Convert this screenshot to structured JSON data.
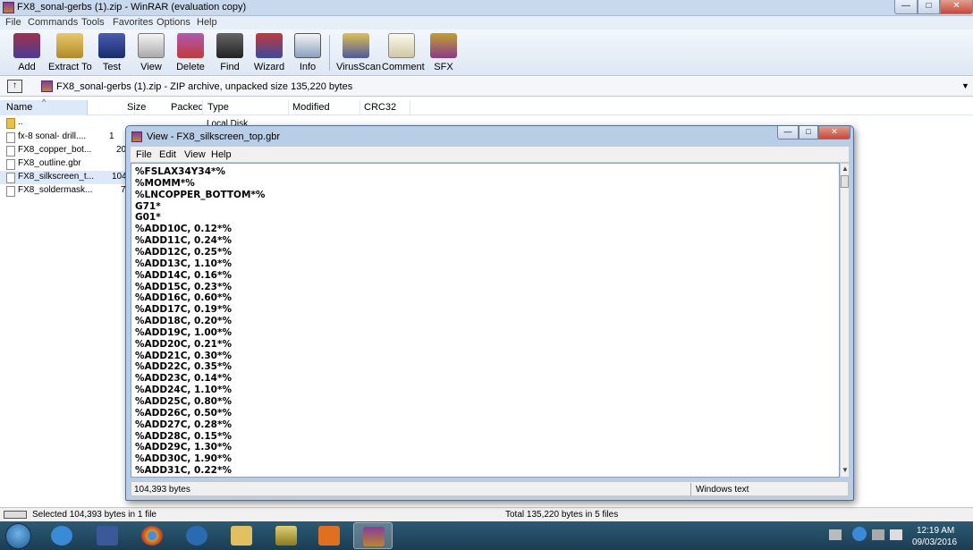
{
  "window": {
    "title": "FX8_sonal-gerbs (1).zip - WinRAR (evaluation copy)",
    "controls": {
      "minimize": "—",
      "maximize": "□",
      "close": "✕"
    }
  },
  "menu": [
    "File",
    "Commands",
    "Tools",
    "Favorites",
    "Options",
    "Help"
  ],
  "toolbar": [
    {
      "label": "Add",
      "icon": "add-icon",
      "color": "#a0324a"
    },
    {
      "label": "Extract To",
      "icon": "extract-folder-icon",
      "color": "#c9a040"
    },
    {
      "label": "Test",
      "icon": "test-book-icon",
      "color": "#2a3c8c"
    },
    {
      "label": "View",
      "icon": "view-glasses-icon",
      "color": "#8a8a8a"
    },
    {
      "label": "Delete",
      "icon": "delete-books-icon",
      "color": "#8a3a8a"
    },
    {
      "label": "Find",
      "icon": "find-binoculars-icon",
      "color": "#444444"
    },
    {
      "label": "Wizard",
      "icon": "wizard-hat-icon",
      "color": "#5a4aa0"
    },
    {
      "label": "Info",
      "icon": "info-icon",
      "color": "#3a5a8c"
    },
    {
      "label": "VirusScan",
      "icon": "virusscan-icon",
      "color": "#c0a030"
    },
    {
      "label": "Comment",
      "icon": "comment-icon",
      "color": "#d0d0c0"
    },
    {
      "label": "SFX",
      "icon": "sfx-icon",
      "color": "#b04a8a"
    }
  ],
  "address": {
    "text": "FX8_sonal-gerbs (1).zip - ZIP archive, unpacked size 135,220 bytes",
    "up_icon": "↑",
    "dropdown_icon": "▼"
  },
  "columns": {
    "name": "Name",
    "sort_indicator": "^",
    "size": "Size",
    "packed": "Packed",
    "type": "Type",
    "modified": "Modified",
    "crc": "CRC32"
  },
  "local_disk": "Local Disk",
  "files": [
    {
      "name": "..",
      "size": "",
      "kind": "folder"
    },
    {
      "name": "fx-8 sonal- drill....",
      "size": "1",
      "kind": "file"
    },
    {
      "name": "FX8_copper_bot...",
      "size": "20",
      "kind": "file"
    },
    {
      "name": "FX8_outline.gbr",
      "size": "",
      "kind": "file"
    },
    {
      "name": "FX8_silkscreen_t...",
      "size": "104",
      "kind": "file",
      "selected": true
    },
    {
      "name": "FX8_soldermask...",
      "size": "7",
      "kind": "file"
    }
  ],
  "status": {
    "left": "Selected 104,393 bytes in 1 file",
    "right": "Total 135,220 bytes in 5 files"
  },
  "viewer": {
    "title": "View - FX8_silkscreen_top.gbr",
    "controls": {
      "minimize": "—",
      "maximize": "□",
      "close": "✕"
    },
    "menu": [
      "File",
      "Edit",
      "View",
      "Help"
    ],
    "lines": [
      "%FSLAX34Y34*%",
      "%MOMM*%",
      "%LNCOPPER_BOTTOM*%",
      "G71*",
      "G01*",
      "%ADD10C, 0.12*%",
      "%ADD11C, 0.24*%",
      "%ADD12C, 0.25*%",
      "%ADD13C, 1.10*%",
      "%ADD14C, 0.16*%",
      "%ADD15C, 0.23*%",
      "%ADD16C, 0.60*%",
      "%ADD17C, 0.19*%",
      "%ADD18C, 0.20*%",
      "%ADD19C, 1.00*%",
      "%ADD20C, 0.21*%",
      "%ADD21C, 0.30*%",
      "%ADD22C, 0.35*%",
      "%ADD23C, 0.14*%",
      "%ADD24C, 1.10*%",
      "%ADD25C, 0.80*%",
      "%ADD26C, 0.50*%",
      "%ADD27C, 0.28*%",
      "%ADD28C, 0.15*%",
      "%ADD29C, 1.30*%",
      "%ADD30C, 1.90*%",
      "%ADD31C, 0.22*%"
    ],
    "status_left": "104,393 bytes",
    "status_right": "Windows text",
    "scroll_up": "▲",
    "scroll_down": "▼"
  },
  "taskbar": {
    "apps": [
      {
        "name": "internet-explorer",
        "color": "#3a8ad8"
      },
      {
        "name": "facebook",
        "color": "#3b5998"
      },
      {
        "name": "chrome",
        "color": "#d8a020"
      },
      {
        "name": "hp",
        "color": "#2a6ab0"
      },
      {
        "name": "file-explorer",
        "color": "#e0c060"
      },
      {
        "name": "winrar-sfx",
        "color": "#b0a030"
      },
      {
        "name": "media-player",
        "color": "#e07020"
      },
      {
        "name": "winrar",
        "color": "#8b3a9e"
      }
    ],
    "time": "12:19 AM",
    "date": "09/03/2016"
  }
}
